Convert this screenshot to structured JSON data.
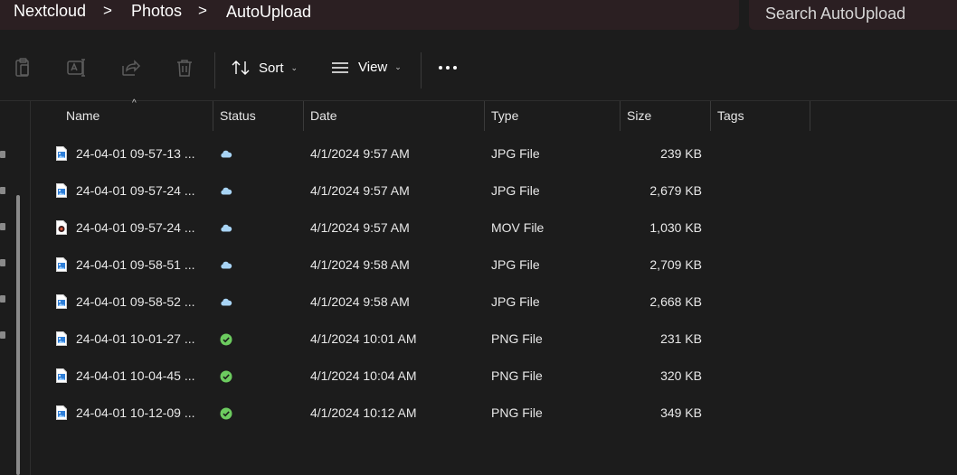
{
  "breadcrumb": {
    "items": [
      "Nextcloud",
      "Photos",
      "AutoUpload"
    ],
    "separator": ">"
  },
  "search": {
    "placeholder": "Search AutoUpload"
  },
  "toolbar": {
    "sort_label": "Sort",
    "view_label": "View",
    "dropdown_chevron": "⌄",
    "more_label": "•••"
  },
  "columns": {
    "name": "Name",
    "status": "Status",
    "date": "Date",
    "type": "Type",
    "size": "Size",
    "tags": "Tags"
  },
  "files": [
    {
      "name": "24-04-01 09-57-13 ...",
      "status": "cloud",
      "date": "4/1/2024 9:57 AM",
      "type": "JPG File",
      "size": "239 KB",
      "icon": "image-file-icon"
    },
    {
      "name": "24-04-01 09-57-24 ...",
      "status": "cloud",
      "date": "4/1/2024 9:57 AM",
      "type": "JPG File",
      "size": "2,679 KB",
      "icon": "image-file-icon"
    },
    {
      "name": "24-04-01 09-57-24 ...",
      "status": "cloud",
      "date": "4/1/2024 9:57 AM",
      "type": "MOV File",
      "size": "1,030 KB",
      "icon": "video-file-icon"
    },
    {
      "name": "24-04-01 09-58-51 ...",
      "status": "cloud",
      "date": "4/1/2024 9:58 AM",
      "type": "JPG File",
      "size": "2,709 KB",
      "icon": "image-file-icon"
    },
    {
      "name": "24-04-01 09-58-52 ...",
      "status": "cloud",
      "date": "4/1/2024 9:58 AM",
      "type": "JPG File",
      "size": "2,668 KB",
      "icon": "image-file-icon"
    },
    {
      "name": "24-04-01 10-01-27 ...",
      "status": "synced",
      "date": "4/1/2024 10:01 AM",
      "type": "PNG File",
      "size": "231 KB",
      "icon": "image-file-icon"
    },
    {
      "name": "24-04-01 10-04-45 ...",
      "status": "synced",
      "date": "4/1/2024 10:04 AM",
      "type": "PNG File",
      "size": "320 KB",
      "icon": "image-file-icon"
    },
    {
      "name": "24-04-01 10-12-09 ...",
      "status": "synced",
      "date": "4/1/2024 10:12 AM",
      "type": "PNG File",
      "size": "349 KB",
      "icon": "image-file-icon"
    }
  ],
  "colors": {
    "background": "#1c1c1c",
    "address_bar": "#2b1f22",
    "cloud_status": "#a8d4f5",
    "synced_status": "#6ccb5f",
    "text": "#e8e8e8"
  }
}
